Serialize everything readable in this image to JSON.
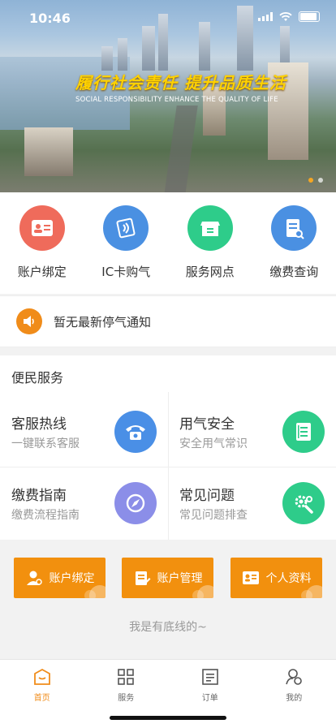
{
  "status_bar": {
    "time": "10:46"
  },
  "banner": {
    "slogan_cn": "履行社会责任 提升品质生活",
    "slogan_en": "SOCIAL RESPONSIBILITY ENHANCE THE QUALITY OF LIFE",
    "active_dot": 0,
    "dot_count": 2
  },
  "quick_actions": [
    {
      "label": "账户绑定",
      "icon": "id-card-icon",
      "color": "#ef6b5b"
    },
    {
      "label": "IC卡购气",
      "icon": "nfc-card-icon",
      "color": "#4a90e2"
    },
    {
      "label": "服务网点",
      "icon": "store-icon",
      "color": "#2ecc8a"
    },
    {
      "label": "缴费查询",
      "icon": "bill-search-icon",
      "color": "#4a90e2"
    }
  ],
  "notice": {
    "text": "暂无最新停气通知",
    "icon": "speaker-icon"
  },
  "services": {
    "title": "便民服务",
    "items": [
      {
        "title": "客服热线",
        "sub": "一键联系客服",
        "icon": "phone-icon",
        "color": "#4a8fe6"
      },
      {
        "title": "用气安全",
        "sub": "安全用气常识",
        "icon": "document-icon",
        "color": "#2ecc8a"
      },
      {
        "title": "缴费指南",
        "sub": "缴费流程指南",
        "icon": "compass-icon",
        "color": "#8b8ee8"
      },
      {
        "title": "常见问题",
        "sub": "常见问题排查",
        "icon": "gear-wrench-icon",
        "color": "#2ecc8a"
      }
    ]
  },
  "orange_buttons": [
    {
      "label": "账户绑定",
      "icon": "user-icon"
    },
    {
      "label": "账户管理",
      "icon": "edit-list-icon"
    },
    {
      "label": "个人资料",
      "icon": "profile-card-icon"
    }
  ],
  "bottom_text": "我是有底线的~",
  "tabs": [
    {
      "label": "首页",
      "icon": "home-icon",
      "active": true
    },
    {
      "label": "服务",
      "icon": "grid-icon",
      "active": false
    },
    {
      "label": "订单",
      "icon": "order-icon",
      "active": false
    },
    {
      "label": "我的",
      "icon": "profile-icon",
      "active": false
    }
  ],
  "colors": {
    "accent": "#f08c1a",
    "orange_button": "#f2900e"
  }
}
